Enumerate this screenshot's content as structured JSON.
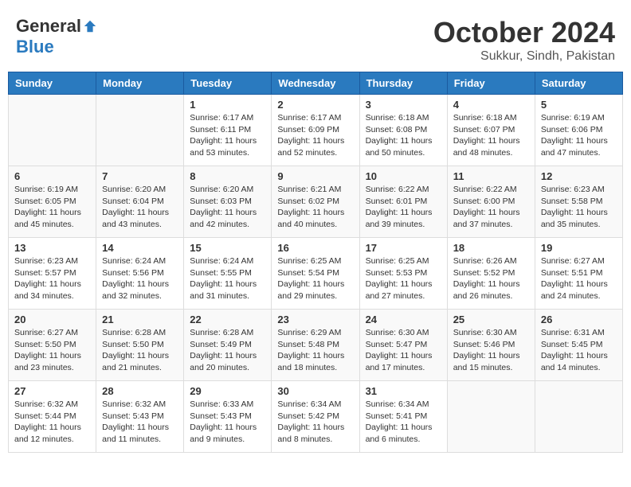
{
  "header": {
    "logo_general": "General",
    "logo_blue": "Blue",
    "month_title": "October 2024",
    "subtitle": "Sukkur, Sindh, Pakistan"
  },
  "weekdays": [
    "Sunday",
    "Monday",
    "Tuesday",
    "Wednesday",
    "Thursday",
    "Friday",
    "Saturday"
  ],
  "weeks": [
    [
      {
        "day": "",
        "sunrise": "",
        "sunset": "",
        "daylight": ""
      },
      {
        "day": "",
        "sunrise": "",
        "sunset": "",
        "daylight": ""
      },
      {
        "day": "1",
        "sunrise": "Sunrise: 6:17 AM",
        "sunset": "Sunset: 6:11 PM",
        "daylight": "Daylight: 11 hours and 53 minutes."
      },
      {
        "day": "2",
        "sunrise": "Sunrise: 6:17 AM",
        "sunset": "Sunset: 6:09 PM",
        "daylight": "Daylight: 11 hours and 52 minutes."
      },
      {
        "day": "3",
        "sunrise": "Sunrise: 6:18 AM",
        "sunset": "Sunset: 6:08 PM",
        "daylight": "Daylight: 11 hours and 50 minutes."
      },
      {
        "day": "4",
        "sunrise": "Sunrise: 6:18 AM",
        "sunset": "Sunset: 6:07 PM",
        "daylight": "Daylight: 11 hours and 48 minutes."
      },
      {
        "day": "5",
        "sunrise": "Sunrise: 6:19 AM",
        "sunset": "Sunset: 6:06 PM",
        "daylight": "Daylight: 11 hours and 47 minutes."
      }
    ],
    [
      {
        "day": "6",
        "sunrise": "Sunrise: 6:19 AM",
        "sunset": "Sunset: 6:05 PM",
        "daylight": "Daylight: 11 hours and 45 minutes."
      },
      {
        "day": "7",
        "sunrise": "Sunrise: 6:20 AM",
        "sunset": "Sunset: 6:04 PM",
        "daylight": "Daylight: 11 hours and 43 minutes."
      },
      {
        "day": "8",
        "sunrise": "Sunrise: 6:20 AM",
        "sunset": "Sunset: 6:03 PM",
        "daylight": "Daylight: 11 hours and 42 minutes."
      },
      {
        "day": "9",
        "sunrise": "Sunrise: 6:21 AM",
        "sunset": "Sunset: 6:02 PM",
        "daylight": "Daylight: 11 hours and 40 minutes."
      },
      {
        "day": "10",
        "sunrise": "Sunrise: 6:22 AM",
        "sunset": "Sunset: 6:01 PM",
        "daylight": "Daylight: 11 hours and 39 minutes."
      },
      {
        "day": "11",
        "sunrise": "Sunrise: 6:22 AM",
        "sunset": "Sunset: 6:00 PM",
        "daylight": "Daylight: 11 hours and 37 minutes."
      },
      {
        "day": "12",
        "sunrise": "Sunrise: 6:23 AM",
        "sunset": "Sunset: 5:58 PM",
        "daylight": "Daylight: 11 hours and 35 minutes."
      }
    ],
    [
      {
        "day": "13",
        "sunrise": "Sunrise: 6:23 AM",
        "sunset": "Sunset: 5:57 PM",
        "daylight": "Daylight: 11 hours and 34 minutes."
      },
      {
        "day": "14",
        "sunrise": "Sunrise: 6:24 AM",
        "sunset": "Sunset: 5:56 PM",
        "daylight": "Daylight: 11 hours and 32 minutes."
      },
      {
        "day": "15",
        "sunrise": "Sunrise: 6:24 AM",
        "sunset": "Sunset: 5:55 PM",
        "daylight": "Daylight: 11 hours and 31 minutes."
      },
      {
        "day": "16",
        "sunrise": "Sunrise: 6:25 AM",
        "sunset": "Sunset: 5:54 PM",
        "daylight": "Daylight: 11 hours and 29 minutes."
      },
      {
        "day": "17",
        "sunrise": "Sunrise: 6:25 AM",
        "sunset": "Sunset: 5:53 PM",
        "daylight": "Daylight: 11 hours and 27 minutes."
      },
      {
        "day": "18",
        "sunrise": "Sunrise: 6:26 AM",
        "sunset": "Sunset: 5:52 PM",
        "daylight": "Daylight: 11 hours and 26 minutes."
      },
      {
        "day": "19",
        "sunrise": "Sunrise: 6:27 AM",
        "sunset": "Sunset: 5:51 PM",
        "daylight": "Daylight: 11 hours and 24 minutes."
      }
    ],
    [
      {
        "day": "20",
        "sunrise": "Sunrise: 6:27 AM",
        "sunset": "Sunset: 5:50 PM",
        "daylight": "Daylight: 11 hours and 23 minutes."
      },
      {
        "day": "21",
        "sunrise": "Sunrise: 6:28 AM",
        "sunset": "Sunset: 5:50 PM",
        "daylight": "Daylight: 11 hours and 21 minutes."
      },
      {
        "day": "22",
        "sunrise": "Sunrise: 6:28 AM",
        "sunset": "Sunset: 5:49 PM",
        "daylight": "Daylight: 11 hours and 20 minutes."
      },
      {
        "day": "23",
        "sunrise": "Sunrise: 6:29 AM",
        "sunset": "Sunset: 5:48 PM",
        "daylight": "Daylight: 11 hours and 18 minutes."
      },
      {
        "day": "24",
        "sunrise": "Sunrise: 6:30 AM",
        "sunset": "Sunset: 5:47 PM",
        "daylight": "Daylight: 11 hours and 17 minutes."
      },
      {
        "day": "25",
        "sunrise": "Sunrise: 6:30 AM",
        "sunset": "Sunset: 5:46 PM",
        "daylight": "Daylight: 11 hours and 15 minutes."
      },
      {
        "day": "26",
        "sunrise": "Sunrise: 6:31 AM",
        "sunset": "Sunset: 5:45 PM",
        "daylight": "Daylight: 11 hours and 14 minutes."
      }
    ],
    [
      {
        "day": "27",
        "sunrise": "Sunrise: 6:32 AM",
        "sunset": "Sunset: 5:44 PM",
        "daylight": "Daylight: 11 hours and 12 minutes."
      },
      {
        "day": "28",
        "sunrise": "Sunrise: 6:32 AM",
        "sunset": "Sunset: 5:43 PM",
        "daylight": "Daylight: 11 hours and 11 minutes."
      },
      {
        "day": "29",
        "sunrise": "Sunrise: 6:33 AM",
        "sunset": "Sunset: 5:43 PM",
        "daylight": "Daylight: 11 hours and 9 minutes."
      },
      {
        "day": "30",
        "sunrise": "Sunrise: 6:34 AM",
        "sunset": "Sunset: 5:42 PM",
        "daylight": "Daylight: 11 hours and 8 minutes."
      },
      {
        "day": "31",
        "sunrise": "Sunrise: 6:34 AM",
        "sunset": "Sunset: 5:41 PM",
        "daylight": "Daylight: 11 hours and 6 minutes."
      },
      {
        "day": "",
        "sunrise": "",
        "sunset": "",
        "daylight": ""
      },
      {
        "day": "",
        "sunrise": "",
        "sunset": "",
        "daylight": ""
      }
    ]
  ]
}
